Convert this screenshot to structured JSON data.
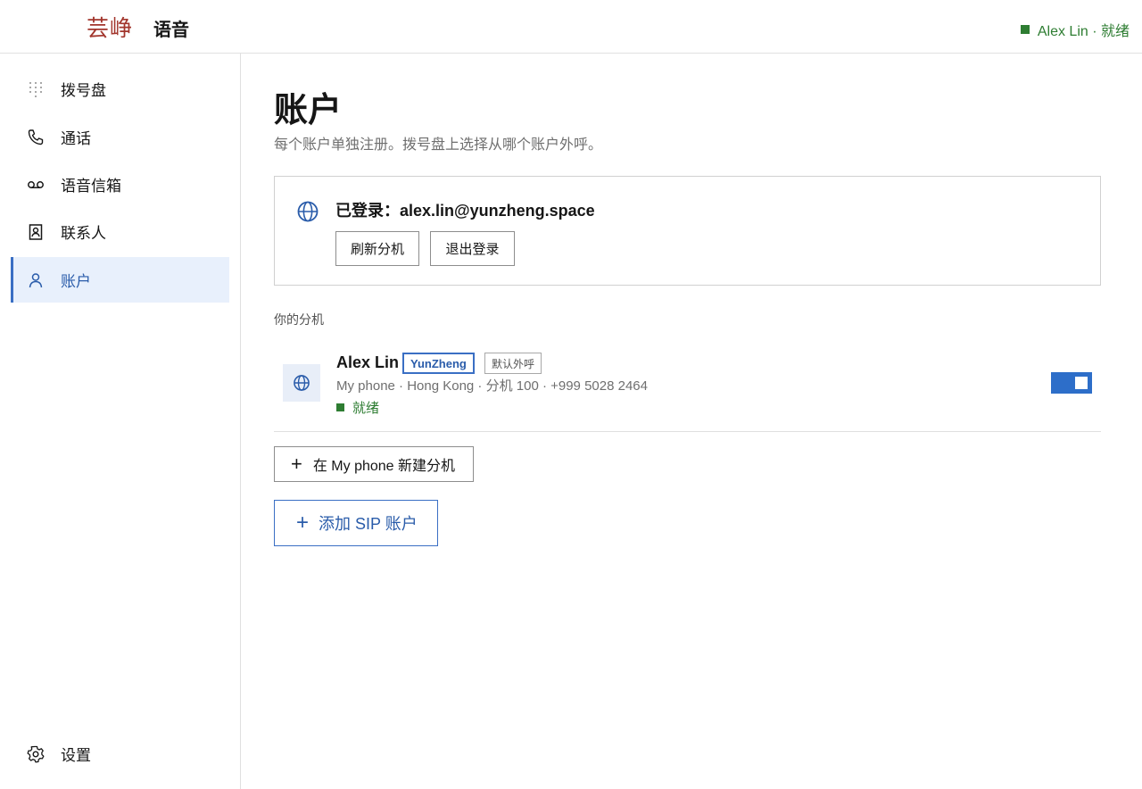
{
  "header": {
    "logo": "芸峥",
    "app_name": "语音",
    "status": "Alex Lin · 就绪"
  },
  "sidebar": {
    "items": [
      {
        "label": "拨号盘",
        "icon": "dialpad-icon"
      },
      {
        "label": "通话",
        "icon": "phone-icon"
      },
      {
        "label": "语音信箱",
        "icon": "voicemail-icon"
      },
      {
        "label": "联系人",
        "icon": "contact-card-icon"
      },
      {
        "label": "账户",
        "icon": "user-icon",
        "active": true
      }
    ],
    "settings": {
      "label": "设置",
      "icon": "gear-icon"
    }
  },
  "main": {
    "title": "账户",
    "subtitle": "每个账户单独注册。拨号盘上选择从哪个账户外呼。",
    "login": {
      "text": "已登录：alex.lin@yunzheng.space",
      "icon": "globe-icon",
      "refresh_label": "刷新分机",
      "logout_label": "退出登录"
    },
    "extensions_heading": "你的分机",
    "extensions": [
      {
        "name": "Alex Lin",
        "brand_tag": "YunZheng",
        "default_tag": "默认外呼",
        "details": "My phone · Hong Kong · 分机 100 · +999 5028 2464",
        "status": "就绪",
        "enabled": true
      }
    ],
    "new_extension_label": "在 My phone 新建分机",
    "add_sip_label": "添加 SIP 账户"
  },
  "colors": {
    "accent": "#3a6fc4",
    "ready": "#2e7d32",
    "logo": "#a2352c"
  }
}
